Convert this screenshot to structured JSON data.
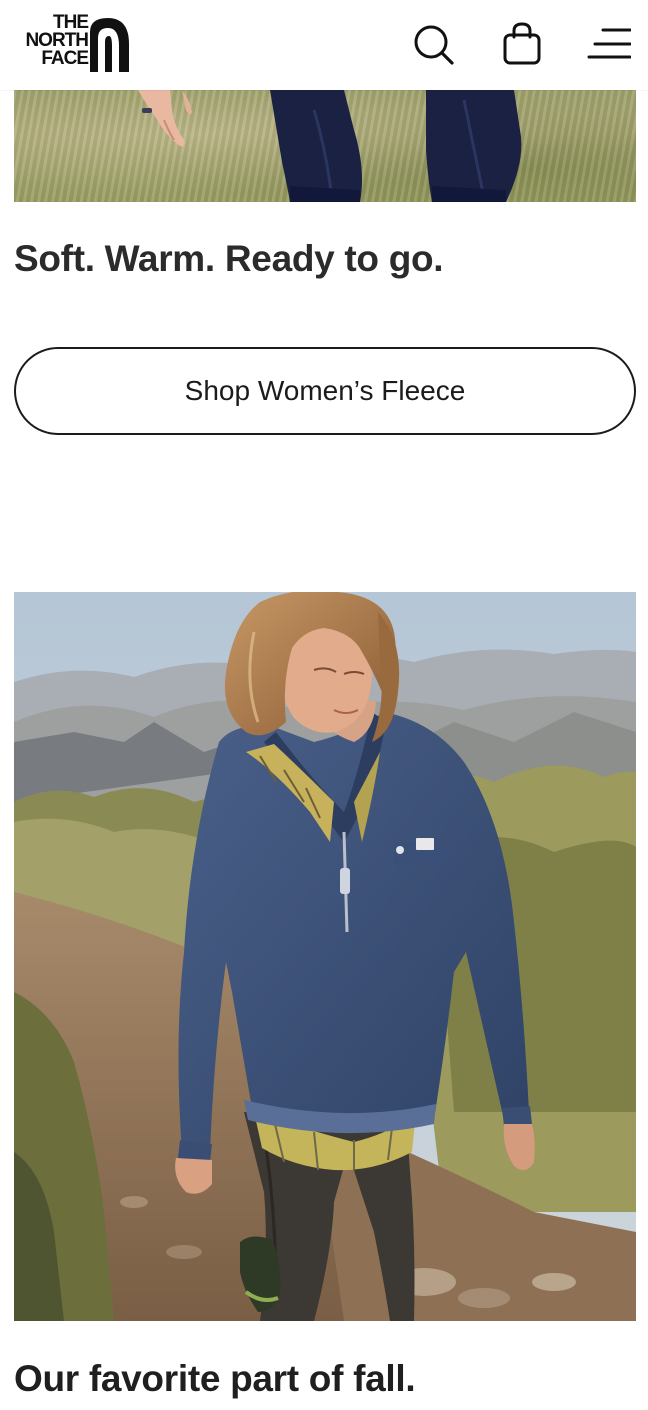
{
  "brand": {
    "logo_text_line1": "THE",
    "logo_text_line2": "NORTH",
    "logo_text_line3": "FACE"
  },
  "header": {
    "icons": [
      "search-icon",
      "shopping-bag-icon",
      "menu-icon"
    ]
  },
  "section1": {
    "heading": "Soft. Warm. Ready to go.",
    "cta_label": "Shop Women’s Fleece",
    "image_subject": "person walking in grass, navy pants"
  },
  "section2": {
    "heading": "Our favorite part of fall.",
    "image_subject": "man in navy quarter-zip fleece hiking a mountain trail"
  },
  "colors": {
    "text": "#1b1b1b",
    "background": "#ffffff",
    "fleece_navy": "#3e5376",
    "pants_navy": "#1a2142"
  }
}
